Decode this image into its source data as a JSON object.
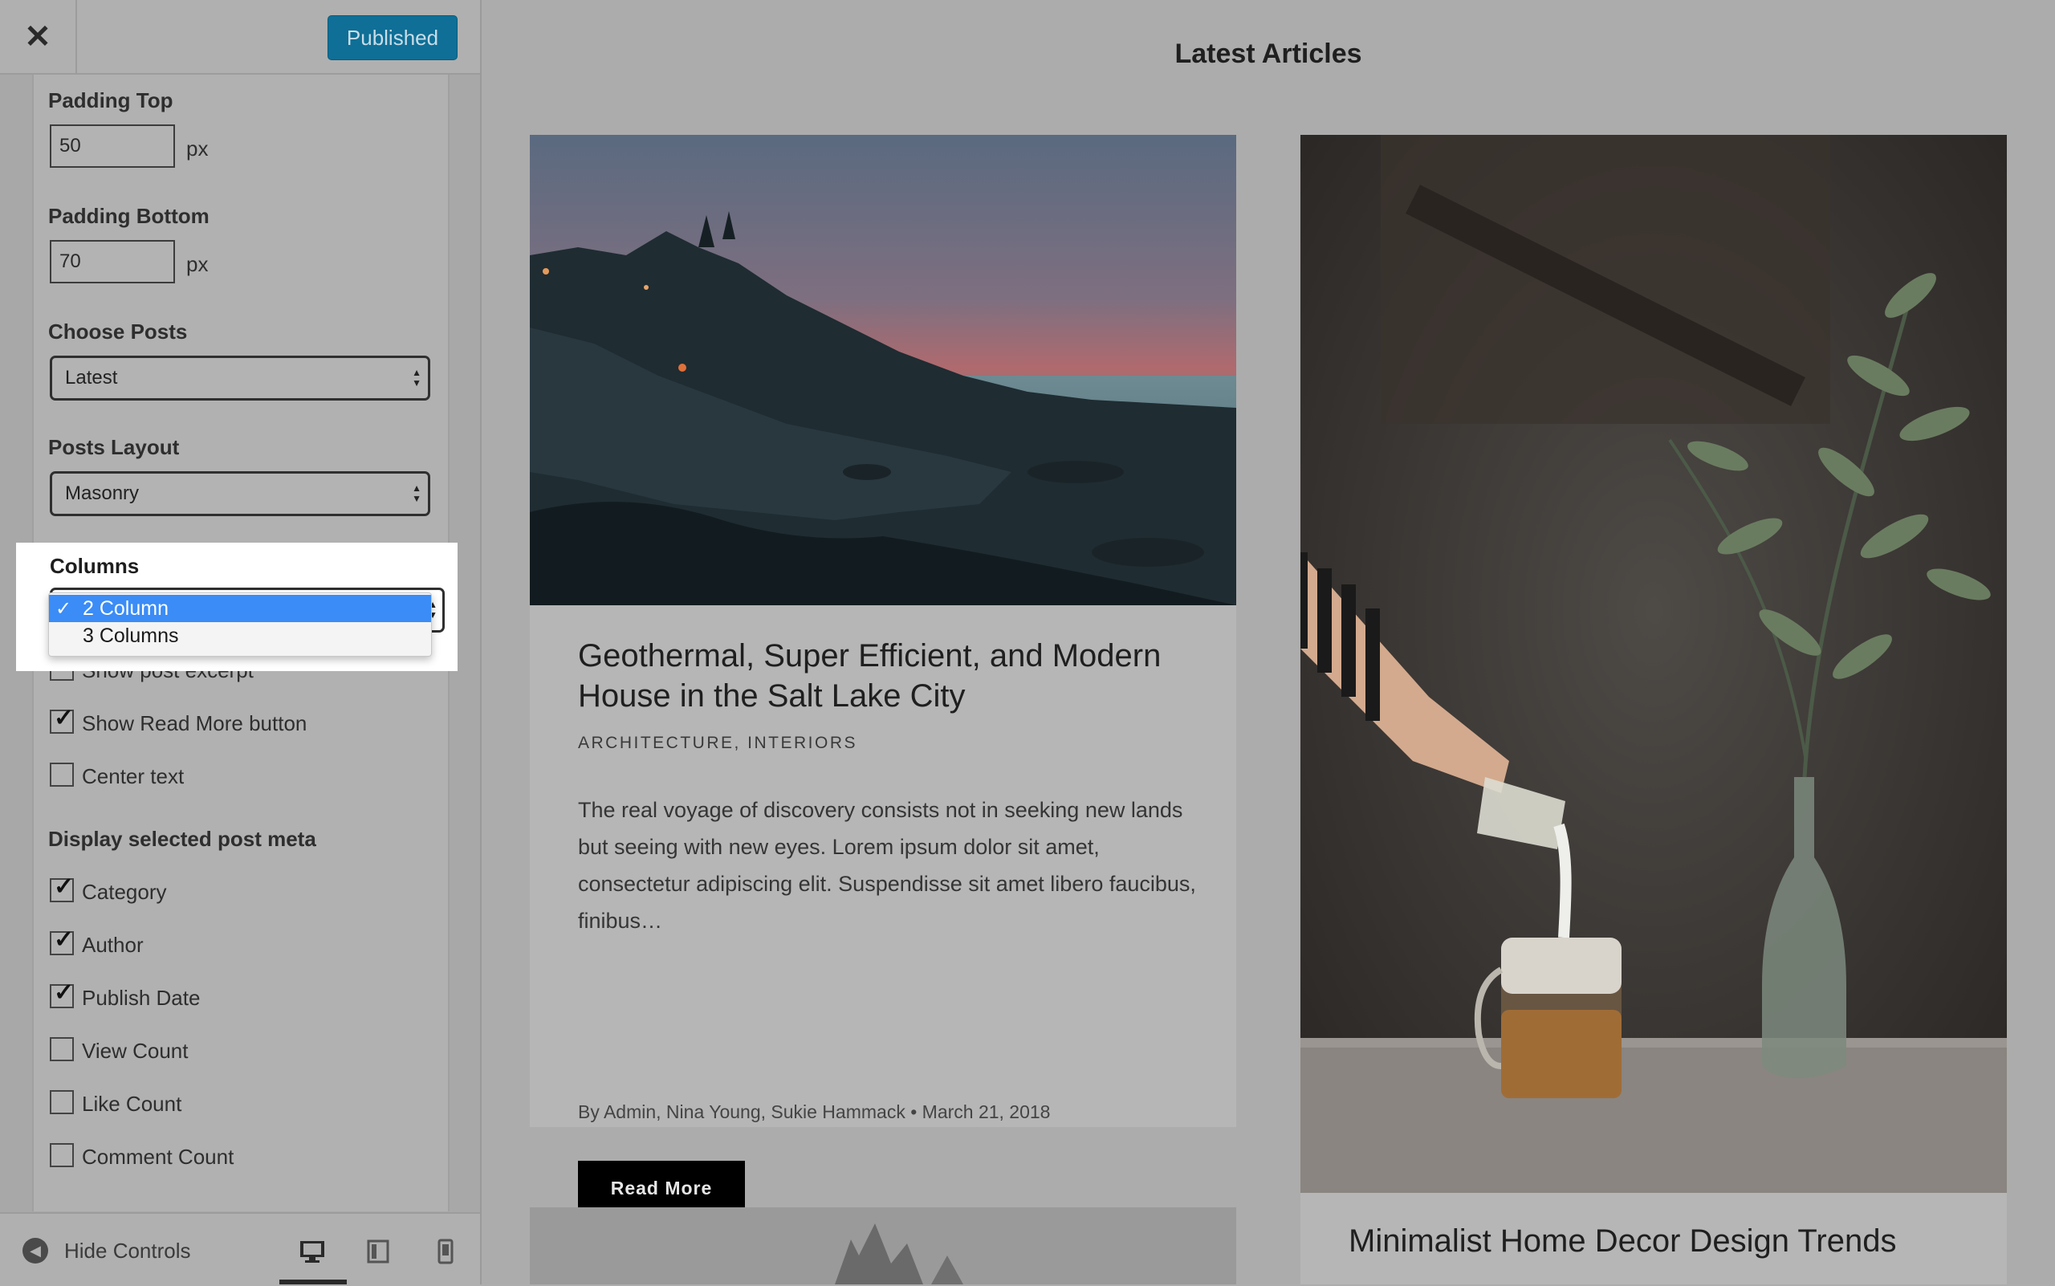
{
  "sidebar": {
    "close_icon": "close-icon",
    "publish_label": "Published",
    "padding_top": {
      "label": "Padding Top",
      "value": "50",
      "unit": "px"
    },
    "padding_bottom": {
      "label": "Padding Bottom",
      "value": "70",
      "unit": "px"
    },
    "choose_posts": {
      "label": "Choose Posts",
      "value": "Latest"
    },
    "posts_layout": {
      "label": "Posts Layout",
      "value": "Masonry"
    },
    "columns": {
      "label": "Columns",
      "options": [
        "2 Column",
        "3 Columns"
      ],
      "selected": "2 Column"
    },
    "checkboxes": [
      {
        "label": "Show post excerpt",
        "checked": true
      },
      {
        "label": "Show Read More button",
        "checked": true
      },
      {
        "label": "Center text",
        "checked": false
      }
    ],
    "meta_heading": "Display selected post meta",
    "meta_checkboxes": [
      {
        "label": "Category",
        "checked": true
      },
      {
        "label": "Author",
        "checked": true
      },
      {
        "label": "Publish Date",
        "checked": true
      },
      {
        "label": "View Count",
        "checked": false
      },
      {
        "label": "Like Count",
        "checked": false
      },
      {
        "label": "Comment Count",
        "checked": false
      }
    ],
    "footer": {
      "hide_controls_label": "Hide Controls",
      "devices": [
        "desktop-icon",
        "tablet-icon",
        "mobile-icon"
      ],
      "active_device": "desktop-icon"
    }
  },
  "preview": {
    "section_title": "Latest Articles",
    "post1": {
      "title": "Geothermal, Super Efficient, and Modern House in the Salt Lake City",
      "categories": "ARCHITECTURE, INTERIORS",
      "excerpt": "The real voyage of discovery consists not in seeking new lands but seeing with new eyes. Lorem ipsum dolor sit amet, consectetur adipiscing elit. Suspendisse sit amet libero faucibus, finibus…",
      "meta": "By Admin, Nina Young, Sukie Hammack  •  March 21, 2018",
      "button": "Read More"
    },
    "post2": {
      "title": "Minimalist Home Decor Design Trends"
    }
  },
  "colors": {
    "accent": "#0f6f96",
    "select_highlight": "#3b8cf6",
    "button_bg": "#000000"
  }
}
